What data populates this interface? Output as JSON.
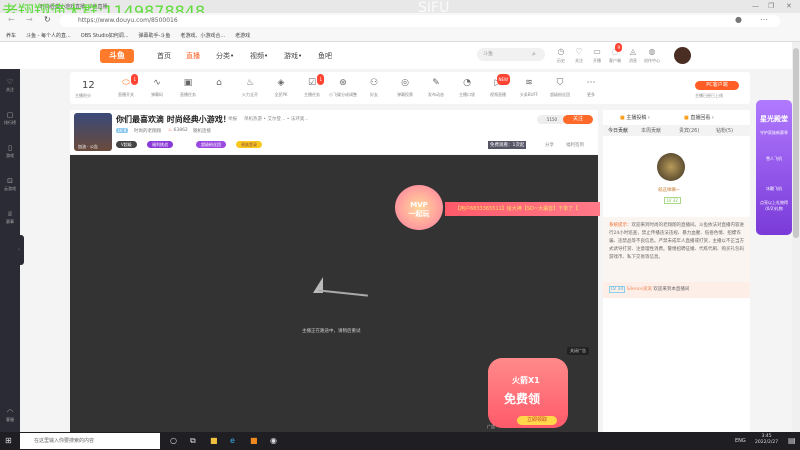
{
  "browser": {
    "tab_title": "时尚经典小游戏直播_斗鱼直播",
    "watermark": "老翔翔滴大群:1149878848",
    "overlay": "SIFU",
    "url": "https://www.douyu.com/8500016",
    "bookmarks": [
      "养车",
      "斗鱼 - 每个人的直...",
      "OBS Studio如何调...",
      "弹幕助手-斗鱼",
      "老游戏、小游戏合...",
      "老游戏"
    ]
  },
  "header": {
    "logo": "斗鱼",
    "nav": [
      "首页",
      "直播",
      "分类•",
      "视频•",
      "游戏•",
      "鱼吧"
    ],
    "search_placeholder": "斗鱼",
    "icons": [
      "历史",
      "关注",
      "开播",
      "客户端",
      "消息",
      "创作中心"
    ],
    "client_badge": "9"
  },
  "sidebar": [
    "关注",
    "排行榜",
    "游戏",
    "云游戏",
    "赛事",
    "客服"
  ],
  "toolbar": {
    "points": "12",
    "points_label": "主播积分",
    "items": [
      "直播开关",
      "弹幕码",
      "直播任务",
      "",
      "火力全开",
      "全民PK",
      "主播任务",
      "小飞碟分成调整",
      "好友",
      "弹幕投票",
      "发布动态",
      "主播口袋",
      "视频直播",
      "头条BUFF",
      "超级粉丝团",
      "更多"
    ],
    "badge1": "1",
    "badge2": "1",
    "new_badge": "NEW",
    "pc_button": "PC客户端",
    "pc_sub": "主播已经已上线"
  },
  "room": {
    "title": "你们最喜欢滴 时尚经典小游戏！",
    "report": "举报",
    "category": "单机热游 • 艾尔登... • 法环奥...",
    "level_tag": "LV 8",
    "streamer": "时尚的老翔翔",
    "hot": "63862",
    "share_tag": "随机连接",
    "badges": [
      "V超级",
      "福利挑战",
      "超级粉丝团",
      "贵族登录"
    ],
    "thumb_caption": "加油 · 公告",
    "followers": "5150",
    "follow_label": "关注",
    "mode_tag": "免费观看：1次起",
    "share": "分享",
    "client_view": "福利签到"
  },
  "video": {
    "banner": "【用户6833365511】给大神【SO~大漏音】下单了【",
    "mvp": "MVP",
    "mvp_sub": "一起玩",
    "offline": "主播正在路途中，请稍后重试",
    "gift_x": "火箭X1",
    "gift_free": "免费领",
    "gift_btn": "立即领取",
    "close_ad": "关闭广告",
    "ad": "广告"
  },
  "right": {
    "links": [
      "主播投稿",
      "直播回看"
    ],
    "tabs": [
      "今日贡献",
      "本周贡献",
      "贵宾(26)",
      "钻粉(5)"
    ],
    "top_fan": "就这样嘛~",
    "top_fan_level": "LV 32",
    "notice_label": "系统提示：",
    "notice": "欢迎来到时尚的老翔翔的直播间。斗鱼依法对直播内容进行24小时巡查，禁止传播违法违规、暴力血腥、低俗色情、招嫖诈骗、违禁品等不良信息。严禁未成年人直播或打赏，主播以不正当方式诱导打赏、注意理性消费。警惕招聘征婚、代练代刷、购买礼包码游戏币、私下交易等信息。",
    "welcome_level": "LV 34",
    "welcome_user": "Silence滚滚",
    "welcome_text": "欢迎来到本直播间"
  },
  "promo": {
    "title": "星光殿堂",
    "sub": "守护家族新赛季",
    "items": [
      "雪人飞机",
      "冰雕飞机"
    ],
    "foot": "点亮以上礼物得(0/2)礼物"
  },
  "taskbar": {
    "search": "在这里输入你要搜索的内容",
    "lang": "ENG",
    "time": "3:45",
    "date": "2022/2/27"
  }
}
